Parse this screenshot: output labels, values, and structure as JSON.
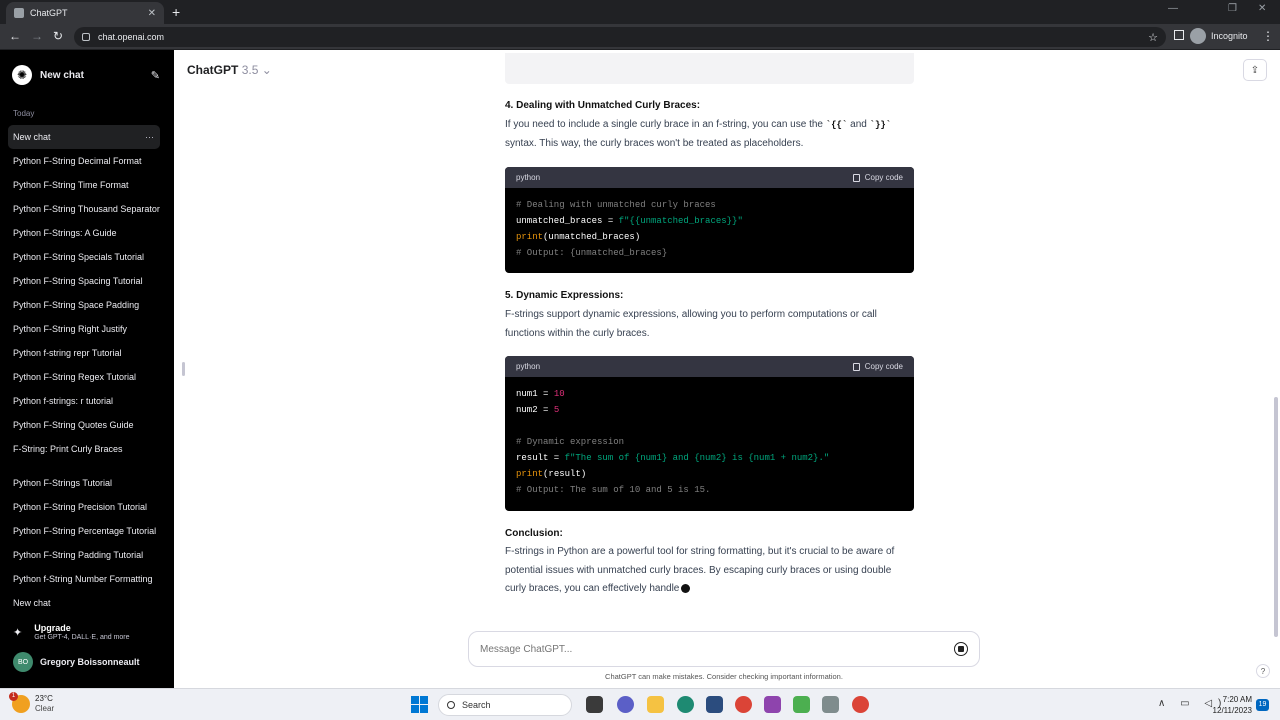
{
  "browser": {
    "tab_title": "ChatGPT",
    "tab_close": "✕",
    "new_tab": "+",
    "url": "chat.openai.com",
    "incognito_label": "Incognito",
    "nav": {
      "back": "←",
      "forward": "→",
      "reload": "↻"
    },
    "window_controls": {
      "minimize": "—",
      "restore": "❐",
      "close": "✕"
    }
  },
  "sidebar": {
    "new_chat_label": "New chat",
    "section_today": "Today",
    "history_group1": [
      "New chat",
      "Python F-String Decimal Format",
      "Python F-String Time Format",
      "Python F-String Thousand Separator",
      "Python F-Strings: A Guide",
      "Python F-String Specials Tutorial",
      "Python F-String Spacing Tutorial",
      "Python F-String Space Padding",
      "Python F-String Right Justify",
      "Python f-string repr Tutorial",
      "Python F-String Regex Tutorial",
      "Python f-strings: r tutorial",
      "Python F-String Quotes Guide",
      "F-String: Print Curly Braces"
    ],
    "history_group2": [
      "Python F-Strings Tutorial",
      "Python F-String Precision Tutorial",
      "Python F-String Percentage Tutorial",
      "Python F-String Padding Tutorial",
      "Python f-String Number Formatting",
      "New chat"
    ],
    "more_icon": "···",
    "upgrade_title": "Upgrade",
    "upgrade_sub": "Get GPT-4, DALL·E, and more",
    "user_initials": "BO",
    "user_name": "Gregory Boissonneault"
  },
  "header": {
    "model_name": "ChatGPT",
    "model_version": "3.5",
    "chevron": "⌄",
    "share_icon": "⇪"
  },
  "content": {
    "section4_heading": "4. Dealing with Unmatched Curly Braces:",
    "section4_text_a": "If you need to include a single curly brace in an f-string, you can use the ",
    "section4_code_1": "`{{`",
    "section4_text_and": " and ",
    "section4_code_2": "`}}`",
    "section4_text_b": " syntax. This way, the curly braces won't be treated as placeholders.",
    "code1": {
      "lang": "python",
      "copy_label": "Copy code",
      "line1": "# Dealing with unmatched curly braces",
      "line2_var": "unmatched_braces = ",
      "line2_str": "f\"{{unmatched_braces}}\"",
      "line3_fn": "print",
      "line3_rest": "(unmatched_braces)",
      "line4": "# Output: {unmatched_braces}"
    },
    "section5_heading": "5. Dynamic Expressions:",
    "section5_text": "F-strings support dynamic expressions, allowing you to perform computations or call functions within the curly braces.",
    "code2": {
      "lang": "python",
      "copy_label": "Copy code",
      "l1_var": "num1 = ",
      "l1_num": "10",
      "l2_var": "num2 = ",
      "l2_num": "5",
      "l4": "# Dynamic expression",
      "l5_var": "result = ",
      "l5_str": "f\"The sum of {num1} and {num2} is {num1 + num2}.\"",
      "l6_fn": "print",
      "l6_rest": "(result)",
      "l7": "# Output: The sum of 10 and 5 is 15."
    },
    "conclusion_heading": "Conclusion:",
    "conclusion_text": "F-strings in Python are a powerful tool for string formatting, but it's crucial to be aware of potential issues with unmatched curly braces. By escaping curly braces or using double curly braces, you can effectively handle"
  },
  "composer": {
    "placeholder": "Message ChatGPT...",
    "disclaimer": "ChatGPT can make mistakes. Consider checking important information.",
    "help": "?"
  },
  "taskbar": {
    "weather_badge": "1",
    "temperature": "23°C",
    "condition": "Clear",
    "search_label": "Search",
    "time": "7:20 AM",
    "date": "12/11/2023",
    "notification_count": "19",
    "tray_icons": "∧ ▭ ◁)"
  }
}
